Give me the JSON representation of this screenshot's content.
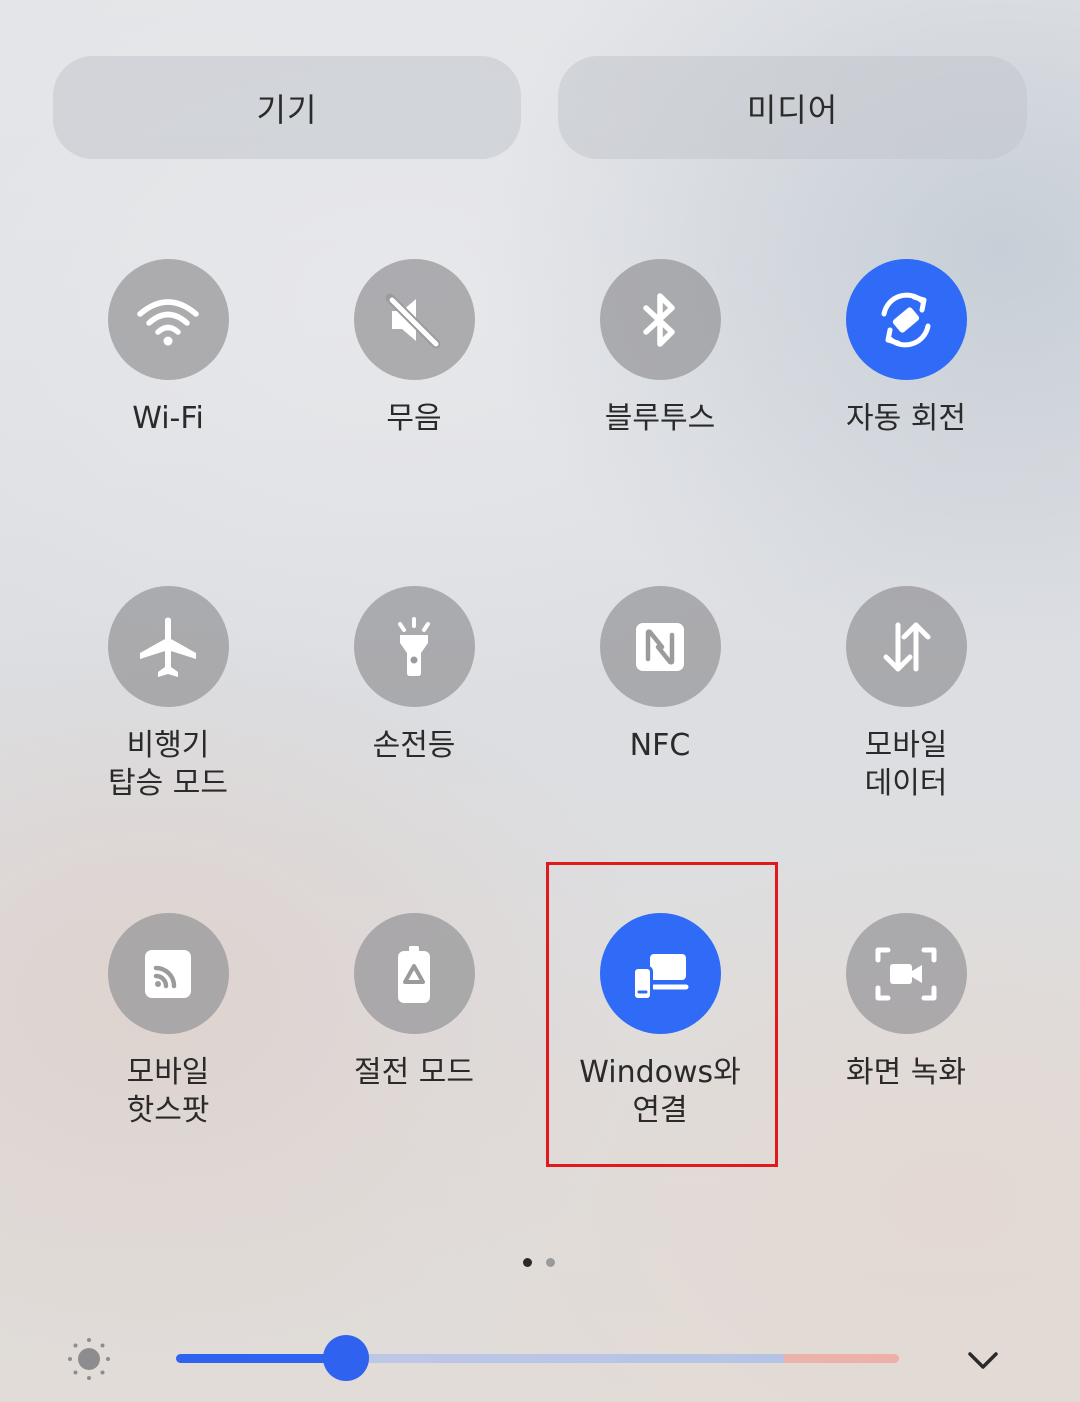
{
  "header": {
    "devices_label": "기기",
    "media_label": "미디어"
  },
  "tiles": [
    {
      "label": "Wi-Fi",
      "icon": "wifi-icon",
      "active": false
    },
    {
      "label": "무음",
      "icon": "mute-icon",
      "active": false
    },
    {
      "label": "블루투스",
      "icon": "bluetooth-icon",
      "active": false
    },
    {
      "label": "자동 회전",
      "icon": "auto-rotate-icon",
      "active": true
    },
    {
      "label": "비행기\n탑승 모드",
      "icon": "airplane-icon",
      "active": false
    },
    {
      "label": "손전등",
      "icon": "flashlight-icon",
      "active": false
    },
    {
      "label": "NFC",
      "icon": "nfc-icon",
      "active": false
    },
    {
      "label": "모바일\n데이터",
      "icon": "mobile-data-icon",
      "active": false
    },
    {
      "label": "모바일\n핫스팟",
      "icon": "hotspot-icon",
      "active": false
    },
    {
      "label": "절전 모드",
      "icon": "power-saving-icon",
      "active": false
    },
    {
      "label": "Windows와\n연결",
      "icon": "link-to-windows-icon",
      "active": true
    },
    {
      "label": "화면 녹화",
      "icon": "screen-record-icon",
      "active": false
    }
  ],
  "pagination": {
    "pages": 2,
    "current": 1
  },
  "brightness": {
    "level": 0.235,
    "icon": "brightness-icon"
  },
  "expand": {
    "icon": "chevron-down-icon"
  },
  "colors": {
    "accent": "#2f6bf6",
    "inactive_circle": "#96969a",
    "highlight_box": "#e01a1a"
  }
}
